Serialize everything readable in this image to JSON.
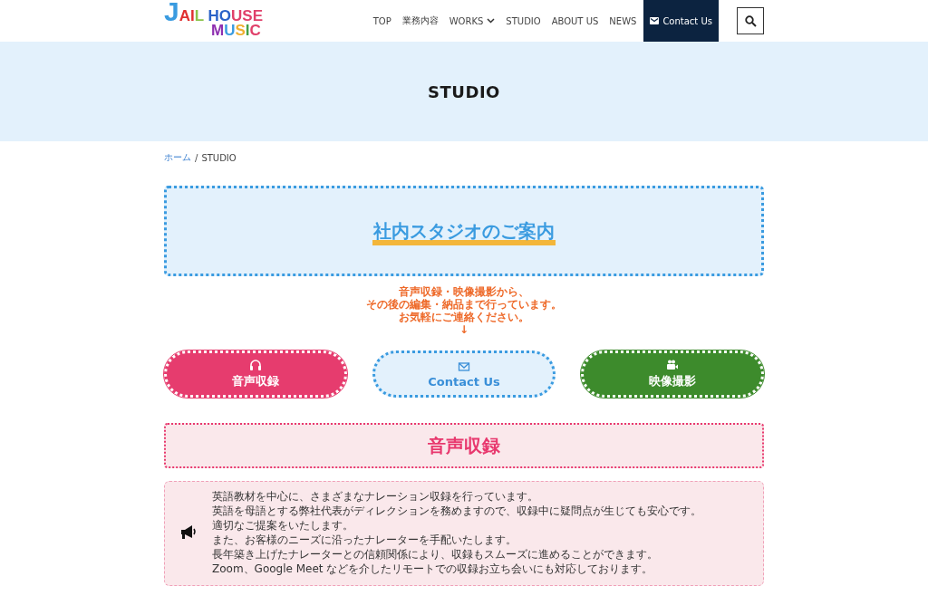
{
  "header": {
    "logo": {
      "line1": "JAIL HOUSE",
      "line2": "MUSIC"
    },
    "nav": [
      {
        "label": "TOP",
        "kind": "link",
        "has_dropdown": false
      },
      {
        "label": "業務内容",
        "kind": "link",
        "has_dropdown": false
      },
      {
        "label": "WORKS",
        "kind": "link",
        "has_dropdown": true
      },
      {
        "label": "STUDIO",
        "kind": "link",
        "has_dropdown": false
      },
      {
        "label": "ABOUT US",
        "kind": "link",
        "has_dropdown": false
      },
      {
        "label": "NEWS",
        "kind": "link",
        "has_dropdown": false
      },
      {
        "label": "Contact Us",
        "kind": "cta",
        "has_dropdown": false
      }
    ]
  },
  "page_title": "STUDIO",
  "breadcrumb_separator": "/",
  "breadcrumb": [
    {
      "label": "ホーム",
      "kind": "link"
    },
    {
      "label": "STUDIO",
      "kind": "current"
    }
  ],
  "intro_heading": "社内スタジオのご案内",
  "intro_text": [
    "音声収録・映像撮影から、",
    "その後の編集・納品まで行っています。",
    "お気軽にご連絡ください。",
    "↓"
  ],
  "buttons": [
    {
      "label": "音声収録",
      "kind": "voice"
    },
    {
      "label": "Contact Us",
      "kind": "contact"
    },
    {
      "label": "映像撮影",
      "kind": "video"
    }
  ],
  "section_heading": "音声収録",
  "info_lines": [
    "英語教材を中心に、さまざまなナレーション収録を行っています。",
    "英語を母語とする弊社代表がディレクションを務めますので、収録中に疑問点が生じても安心です。",
    "適切なご提案をいたします。",
    "また、お客様のニーズに沿ったナレーターを手配いたします。",
    "長年築き上げたナレーターとの信頼関係により、収録もスムーズに進めることができます。",
    "Zoom、Google Meet などを介したリモートでの収録お立ち会いにも対応しております。"
  ]
}
